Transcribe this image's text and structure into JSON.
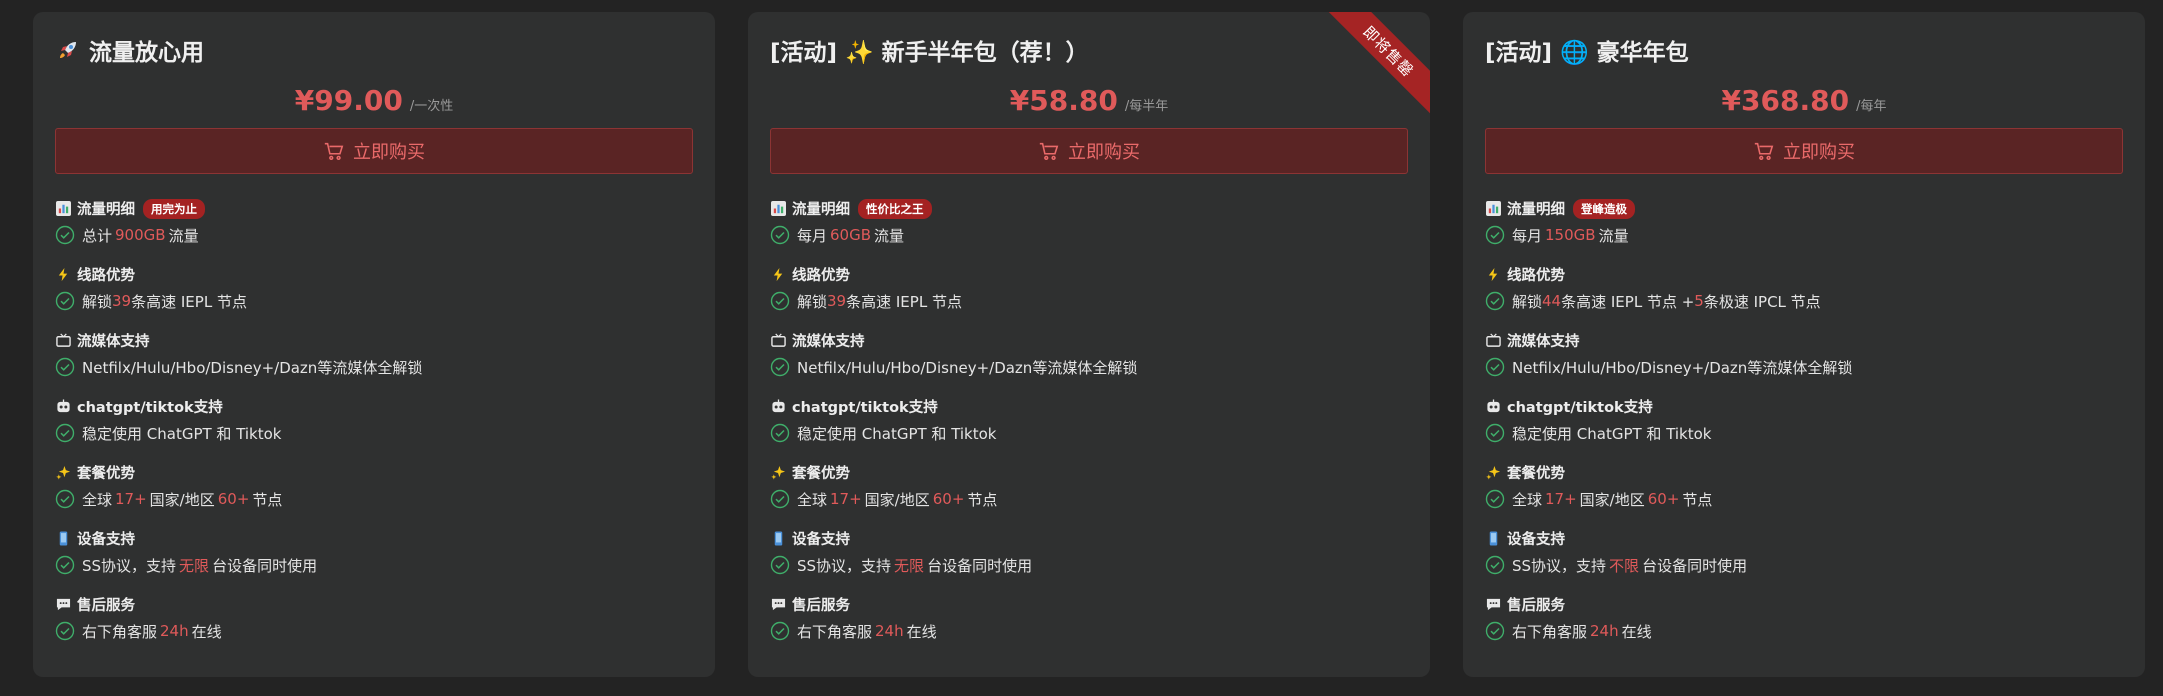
{
  "colors": {
    "page_bg": "#232323",
    "card_bg": "#2f3030",
    "accent": "#e05a5a",
    "button_bg": "#5a2424",
    "badge_bg": "#a42222",
    "check": "#3fae6a"
  },
  "buy_label": "立即购买",
  "sections": {
    "traffic": "流量明细",
    "route": "线路优势",
    "streaming": "流媒体支持",
    "ai": "chatgpt/tiktok支持",
    "plan": "套餐优势",
    "device": "设备支持",
    "support": "售后服务"
  },
  "common": {
    "streaming_line": "Netfilx/Hulu/Hbo/Disney+/Dazn等流媒体全解锁",
    "ai_line": "稳定使用 ChatGPT 和 Tiktok",
    "plan_pre": "全球",
    "plan_countries": "17+",
    "plan_mid": "国家/地区",
    "plan_nodes": "60+",
    "plan_post": "节点",
    "device_pre": "SS协议，支持",
    "device_post": "台设备同时使用",
    "support_pre": "右下角客服",
    "support_hl": "24h",
    "support_post": "在线"
  },
  "plans": [
    {
      "title": "流量放心用",
      "icon": "rocket-icon",
      "price": "¥99.00",
      "period": "/一次性",
      "badge": "用完为止",
      "traffic_pre": "总计",
      "traffic_value": "900GB",
      "traffic_post": "流量",
      "route_pre": "解锁",
      "route_count": "39",
      "route_post": "条高速 IEPL 节点",
      "device_hl": "无限"
    },
    {
      "title": "[活动] ✨ 新手半年包（荐！）",
      "icon": "sparkles-icon",
      "price": "¥58.80",
      "period": "/每半年",
      "badge": "性价比之王",
      "ribbon": "即将售罄",
      "traffic_pre": "每月",
      "traffic_value": "60GB",
      "traffic_post": "流量",
      "route_pre": "解锁",
      "route_count": "39",
      "route_post": "条高速 IEPL 节点",
      "device_hl": "无限"
    },
    {
      "title": "[活动] 🌐 豪华年包",
      "icon": "globe-icon",
      "price": "¥368.80",
      "period": "/每年",
      "badge": "登峰造极",
      "traffic_pre": "每月",
      "traffic_value": "150GB",
      "traffic_post": "流量",
      "route_pre": "解锁",
      "route_count": "44",
      "route_mid": "条高速 IEPL 节点 +",
      "route_count2": "5",
      "route_post": "条极速 IPCL 节点",
      "device_hl": "不限"
    }
  ]
}
